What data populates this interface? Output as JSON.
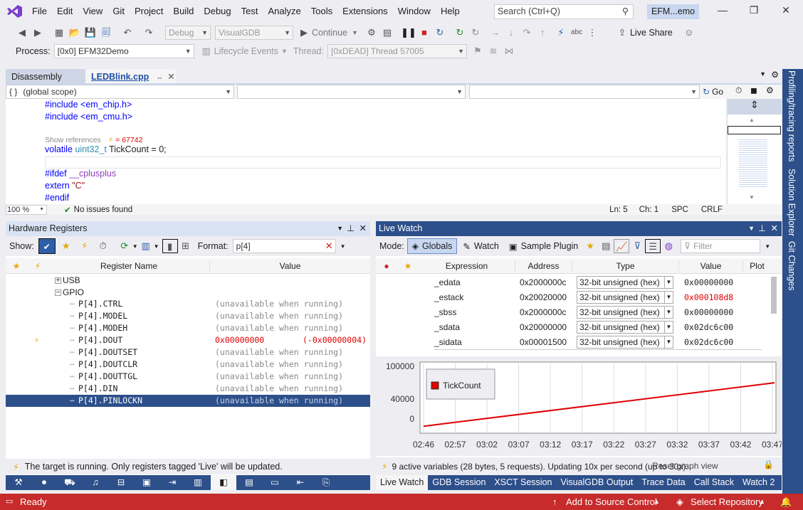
{
  "menu": [
    "File",
    "Edit",
    "View",
    "Git",
    "Project",
    "Build",
    "Debug",
    "Test",
    "Analyze",
    "Tools",
    "Extensions",
    "Window",
    "Help"
  ],
  "search_placeholder": "Search (Ctrl+Q)",
  "solution_name": "EFM...emo",
  "toolbar1": {
    "config": "Debug",
    "platform": "VisualGDB",
    "continue": "Continue",
    "live_share": "Live Share"
  },
  "toolbar2": {
    "process_label": "Process:",
    "process_value": "[0x0] EFM32Demo",
    "lifecycle": "Lifecycle Events",
    "thread_label": "Thread:",
    "thread_value": "[0xDEAD] Thread 57005"
  },
  "doc_tabs": {
    "disassembly": "Disassembly",
    "active": "LEDBlink.cpp"
  },
  "scope": "(global scope)",
  "go_label": "Go",
  "code": {
    "l1": "#include <em_chip.h>",
    "l2": "#include <em_cmu.h>",
    "refs": "Show references",
    "refs_val": "= 67742",
    "l4a": "volatile",
    "l4b": "uint32_t",
    "l4c": " TickCount = 0;",
    "l6a": "#ifdef",
    "l6b": " __cplusplus",
    "l7a": "extern ",
    "l7b": "\"C\"",
    "l8": "#endif"
  },
  "editor_status": {
    "zoom": "100 %",
    "issues": "No issues found",
    "ln": "Ln: 5",
    "ch": "Ch: 1",
    "spc": "SPC",
    "crlf": "CRLF"
  },
  "hwreg": {
    "title": "Hardware Registers",
    "show": "Show:",
    "format_label": "Format:",
    "format_value": "p[4]",
    "col_name": "Register Name",
    "col_value": "Value",
    "usb": "USB",
    "gpio": "GPIO",
    "rows": [
      {
        "name": "P[4].CTRL",
        "value": "(unavailable when running)"
      },
      {
        "name": "P[4].MODEL",
        "value": "(unavailable when running)"
      },
      {
        "name": "P[4].MODEH",
        "value": "(unavailable when running)"
      },
      {
        "name": "P[4].DOUT",
        "value": "0x00000000",
        "extra": "(-0x00000004)"
      },
      {
        "name": "P[4].DOUTSET",
        "value": "(unavailable when running)"
      },
      {
        "name": "P[4].DOUTCLR",
        "value": "(unavailable when running)"
      },
      {
        "name": "P[4].DOUTTGL",
        "value": "(unavailable when running)"
      },
      {
        "name": "P[4].DIN",
        "value": "(unavailable when running)"
      },
      {
        "name": "P[4].PINLOCKN",
        "value": "(unavailable when running)"
      }
    ],
    "footer": "The target is running. Only registers tagged 'Live' will be updated."
  },
  "live": {
    "title": "Live Watch",
    "mode": "Mode:",
    "globals": "Globals",
    "watch": "Watch",
    "plugin": "Sample Plugin",
    "filter": "Filter",
    "cols": [
      "Expression",
      "Address",
      "Type",
      "Value",
      "Plot"
    ],
    "rows": [
      {
        "expr": "_edata",
        "addr": "0x2000000c",
        "type": "32-bit unsigned (hex)",
        "val": "0x00000000",
        "red": false
      },
      {
        "expr": "_estack",
        "addr": "0x20020000",
        "type": "32-bit unsigned (hex)",
        "val": "0x000108d8",
        "red": true
      },
      {
        "expr": "_sbss",
        "addr": "0x2000000c",
        "type": "32-bit unsigned (hex)",
        "val": "0x00000000",
        "red": false
      },
      {
        "expr": "_sdata",
        "addr": "0x20000000",
        "type": "32-bit unsigned (hex)",
        "val": "0x02dc6c00",
        "red": false
      },
      {
        "expr": "_sidata",
        "addr": "0x00001500",
        "type": "32-bit unsigned (hex)",
        "val": "0x02dc6c00",
        "red": false
      }
    ],
    "footer": "9 active variables (28 bytes, 5 requests). Updating 10x per second (up to 30x).",
    "footer_overlap": "Reset graph view"
  },
  "chart_data": {
    "type": "line",
    "series": [
      {
        "name": "TickCount",
        "color": "#e00000",
        "x": [
          "02:46",
          "03:47"
        ],
        "values": [
          2000,
          72000
        ]
      }
    ],
    "categories": [
      "02:46",
      "02:57",
      "03:02",
      "03:07",
      "03:12",
      "03:17",
      "03:22",
      "03:27",
      "03:32",
      "03:37",
      "03:42",
      "03:47"
    ],
    "yticks": [
      "100000",
      "40000",
      "0"
    ],
    "ylim": [
      0,
      110000
    ],
    "legend": "top-left"
  },
  "bottom_tabs_left": [
    "wrench",
    "stop",
    "debug",
    "music",
    "book",
    "cpu",
    "arrow",
    "chip",
    "layers",
    "table",
    "terminal",
    "export",
    "clip"
  ],
  "bottom_tabs_right": [
    "Live Watch",
    "GDB Session",
    "XSCT Session",
    "VisualGDB Output",
    "Trace Data",
    "Call Stack",
    "Watch 2"
  ],
  "side_tabs": [
    "Profiling/tracing reports",
    "Solution Explorer",
    "Git Changes"
  ],
  "status": {
    "ready": "Ready",
    "source": "Add to Source Control",
    "repo": "Select Repository"
  },
  "colors": {
    "accent": "#2d4f8a",
    "status": "#c72b2b",
    "plot": "#e00000"
  }
}
